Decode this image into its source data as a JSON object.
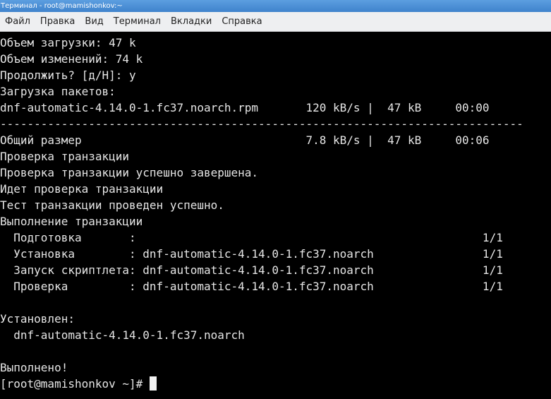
{
  "window": {
    "title": "Терминал - root@mamishonkov:~"
  },
  "menu": {
    "items": [
      {
        "label": "Файл"
      },
      {
        "label": "Правка"
      },
      {
        "label": "Вид"
      },
      {
        "label": "Терминал"
      },
      {
        "label": "Вкладки"
      },
      {
        "label": "Справка"
      }
    ]
  },
  "terminal": {
    "lines": [
      "Объем загрузки: 47 k",
      "Объем изменений: 74 k",
      "Продолжить? [д/Н]: y",
      "Загрузка пакетов:",
      "dnf-automatic-4.14.0-1.fc37.noarch.rpm       120 kB/s |  47 kB     00:00",
      "-----------------------------------------------------------------------------",
      "Общий размер                                 7.8 kB/s |  47 kB     00:06",
      "Проверка транзакции",
      "Проверка транзакции успешно завершена.",
      "Идет проверка транзакции",
      "Тест транзакции проведен успешно.",
      "Выполнение транзакции",
      "  Подготовка       :                                                   1/1",
      "  Установка        : dnf-automatic-4.14.0-1.fc37.noarch                1/1",
      "  Запуск скриптлета: dnf-automatic-4.14.0-1.fc37.noarch                1/1",
      "  Проверка         : dnf-automatic-4.14.0-1.fc37.noarch                1/1",
      "",
      "Установлен:",
      "  dnf-automatic-4.14.0-1.fc37.noarch",
      "",
      "Выполнено!"
    ],
    "prompt": "[root@mamishonkov ~]# "
  }
}
